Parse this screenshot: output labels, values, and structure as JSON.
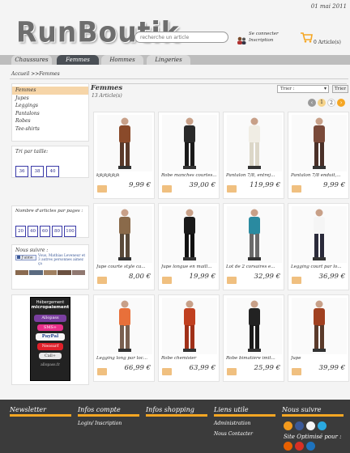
{
  "header": {
    "date": "01 mai 2011",
    "logo": "RunBoutik",
    "search_placeholder": "recherche un article",
    "login_line1": "Se connecter",
    "login_line2": "Inscription",
    "cart_label": "0 Article(s)"
  },
  "nav": {
    "tabs": [
      "Chaussures",
      "Femmes",
      "Hommes",
      "Lingeries"
    ],
    "active": "Femmes"
  },
  "breadcrumb": "Accueil >>Femmes",
  "sidebar": {
    "categories": [
      "Femmes",
      "Jupes",
      "Leggings",
      "Pantalons",
      "Robes",
      "Tee-shirts"
    ],
    "selected": "Femmes",
    "size_title": "Tri par taille:",
    "sizes": [
      "36",
      "38",
      "40"
    ],
    "perpage_title": "Nombre d'articles par pages :",
    "perpage": [
      "20",
      "40",
      "60",
      "80",
      "100"
    ],
    "follow_title": "Nous suivre :",
    "fb_line1": "Vous, Mathias Leveneur et",
    "fb_line2": "3 autres personnes aimez",
    "fb_line3": "ça",
    "fb_button": "J'aime",
    "ad": {
      "line1": "Hébergement",
      "line2": "micropaiement",
      "items": [
        "Allopass",
        "SMS+",
        "PayPal",
        "Neosurf",
        "Call+"
      ],
      "footer": "allopass.fr"
    }
  },
  "main": {
    "title": "Femmes",
    "count": "13 Article(s)",
    "sort_label": "Trier :",
    "sort_button": "Trier",
    "pages": [
      "1",
      "2"
    ],
    "products": [
      {
        "name": "kjkjkjkjkjk",
        "price": "9,99 €"
      },
      {
        "name": "Robe manches courtes...",
        "price": "39,00 €"
      },
      {
        "name": "Pantalon 7/8, entrej...",
        "price": "119,99 €"
      },
      {
        "name": "Pantalon 7/8 enduit,...",
        "price": "9,99 €"
      },
      {
        "name": "Jupe courte style ca...",
        "price": "8,00 €"
      },
      {
        "name": "Jupe longue en maill...",
        "price": "19,99 €"
      },
      {
        "name": "Lot de 2 corsaires e...",
        "price": "32,99 €"
      },
      {
        "name": "Legging court par lo...",
        "price": "36,99 €"
      },
      {
        "name": "Legging long par loc...",
        "price": "66,99 €"
      },
      {
        "name": "Robe chemisier",
        "price": "63,99 €"
      },
      {
        "name": "Robe bimatière imit...",
        "price": "25,99 €"
      },
      {
        "name": "Jupe",
        "price": "39,99 €"
      }
    ]
  },
  "footer": {
    "cols": [
      {
        "title": "Newsletter",
        "links": []
      },
      {
        "title": "Infos compte",
        "links": [
          "Login/ Inscription"
        ]
      },
      {
        "title": "Infos shopping",
        "links": []
      },
      {
        "title": "Liens utile",
        "links": [
          "Administration",
          "Nous Contacter"
        ]
      },
      {
        "title": "Nous suivre",
        "links": []
      }
    ],
    "optimized": "Site Optimisé pour :"
  },
  "colors": {
    "accent": "#f5a623",
    "nav_active": "#4a4f55",
    "footer_bg": "#3b3b3b",
    "sel": "#f6d5a8"
  }
}
